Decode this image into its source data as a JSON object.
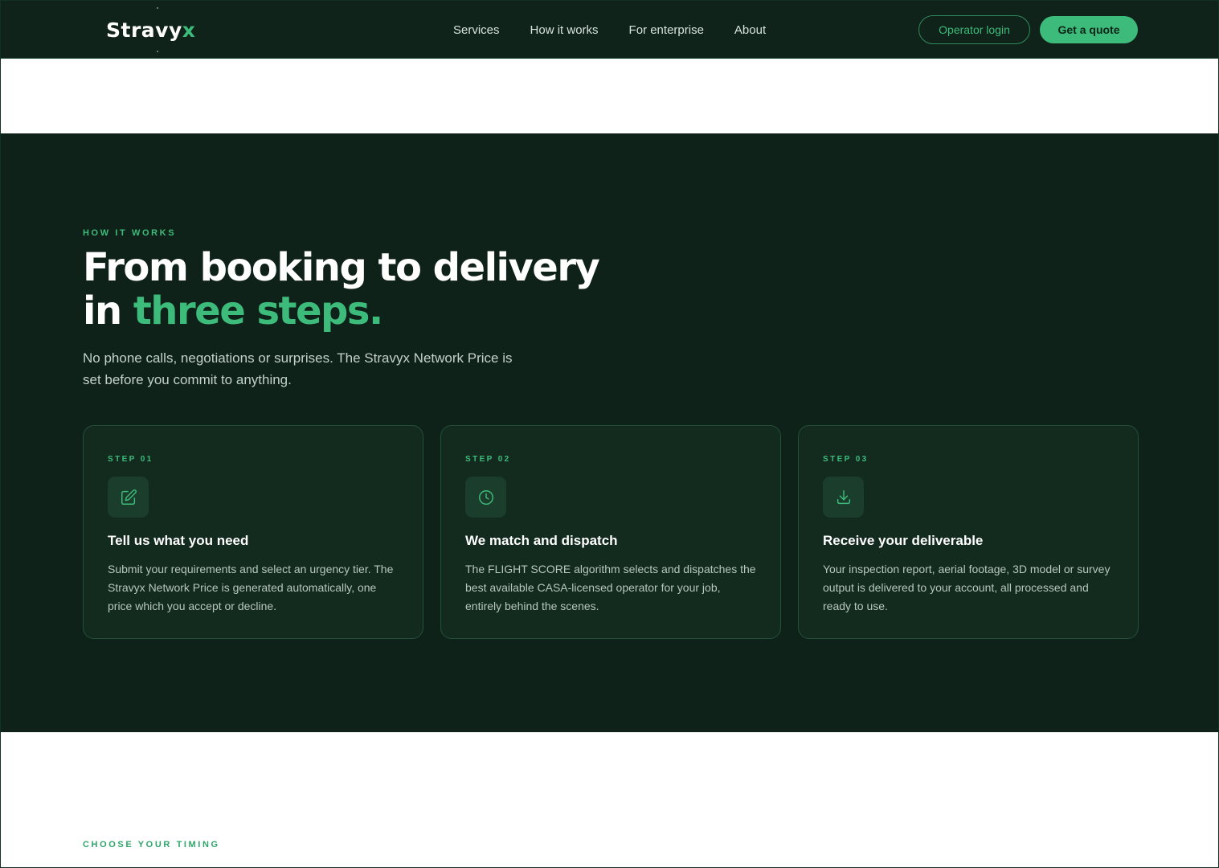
{
  "brand": {
    "name_main": "Stravy",
    "name_accent": "x"
  },
  "nav": {
    "links": [
      "Services",
      "How it works",
      "For enterprise",
      "About"
    ],
    "operator_login": "Operator login",
    "get_quote": "Get a quote"
  },
  "how_it_works": {
    "eyebrow": "HOW IT WORKS",
    "headline_line1": "From booking to delivery",
    "headline_line2_prefix": "in ",
    "headline_line2_accent": "three steps.",
    "subtext": "No phone calls, negotiations or surprises. The Stravyx Network Price is set before you commit to anything.",
    "steps": [
      {
        "label": "STEP 01",
        "icon": "edit-icon",
        "title": "Tell us what you need",
        "body": "Submit your requirements and select an urgency tier. The Stravyx Network Price is generated automatically, one price which you accept or decline."
      },
      {
        "label": "STEP 02",
        "icon": "clock-icon",
        "title": "We match and dispatch",
        "body": "The FLIGHT SCORE algorithm selects and dispatches the best available CASA-licensed operator for your job, entirely behind the scenes."
      },
      {
        "label": "STEP 03",
        "icon": "download-icon",
        "title": "Receive your deliverable",
        "body": "Your inspection report, aerial footage, 3D model or survey output is delivered to your account, all processed and ready to use."
      }
    ]
  },
  "timing": {
    "eyebrow": "CHOOSE YOUR TIMING"
  },
  "colors": {
    "accent": "#3dbb7a",
    "dark_bg": "#0f2219",
    "nav_bg": "#10231a"
  }
}
